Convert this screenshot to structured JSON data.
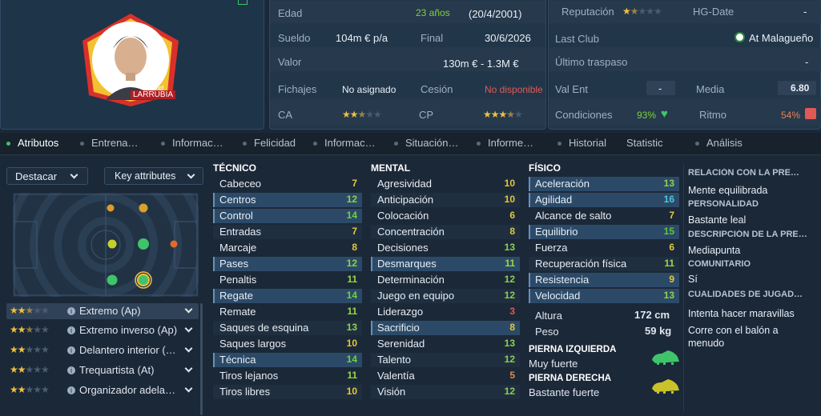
{
  "profile": {
    "name_first": "David",
    "name_last": "LARRUBIA"
  },
  "info": {
    "age_label": "Edad",
    "age_value": "23 años",
    "birth": "(20/4/2001)",
    "wage_label": "Sueldo",
    "wage_value": "104m € p/a",
    "final_label": "Final",
    "final_value": "30/6/2026",
    "value_label": "Valor",
    "value_value": "130m € - 1.3M €",
    "transfers_label": "Fichajes",
    "transfers_value": "No asignado",
    "loan_label": "Cesión",
    "loan_value": "No disponible",
    "ca_label": "CA",
    "ca_stars": 2.5,
    "cp_label": "CP",
    "cp_stars": 3.5
  },
  "info2": {
    "rep_label": "Reputación",
    "rep_stars": 1.5,
    "hg_label": "HG-Date",
    "hg_value": "-",
    "last_club_label": "Last Club",
    "last_club_value": "At Malagueño",
    "last_transfer_label": "Último traspaso",
    "last_transfer_value": "-",
    "val_ent_label": "Val Ent",
    "val_ent_value": "-",
    "media_label": "Media",
    "media_value": "6.80",
    "cond_label": "Condiciones",
    "cond_value": "93%",
    "ritmo_label": "Ritmo",
    "ritmo_value": "54%"
  },
  "tabs": [
    {
      "label": "Atributos",
      "active": true
    },
    {
      "label": "Entrena…",
      "active": false
    },
    {
      "label": "Informac…",
      "active": false
    },
    {
      "label": "Felicidad",
      "active": false
    },
    {
      "label": "Informac…",
      "active": false
    },
    {
      "label": "Situación…",
      "active": false
    },
    {
      "label": "Informe…",
      "active": false
    },
    {
      "label": "Historial",
      "active": false
    },
    {
      "label": "Statistic",
      "active": false
    },
    {
      "label": "Análisis",
      "active": false
    }
  ],
  "left": {
    "highlight_label": "Destacar",
    "key_attr_label": "Key attributes",
    "roles": [
      {
        "label": "Extremo (Ap)",
        "stars": 2.5
      },
      {
        "label": "Extremo inverso (Ap)",
        "stars": 2.5
      },
      {
        "label": "Delantero interior (…",
        "stars": 2
      },
      {
        "label": "Trequartista (At)",
        "stars": 2
      },
      {
        "label": "Organizador adela…",
        "stars": 2
      }
    ]
  },
  "tecnico": {
    "title": "TÉCNICO",
    "rows": [
      {
        "name": "Cabeceo",
        "value": "7",
        "hl": false
      },
      {
        "name": "Centros",
        "value": "12",
        "hl": true
      },
      {
        "name": "Control",
        "value": "14",
        "hl": true
      },
      {
        "name": "Entradas",
        "value": "7",
        "hl": false
      },
      {
        "name": "Marcaje",
        "value": "8",
        "hl": false
      },
      {
        "name": "Pases",
        "value": "12",
        "hl": true
      },
      {
        "name": "Penaltis",
        "value": "11",
        "hl": false
      },
      {
        "name": "Regate",
        "value": "14",
        "hl": true
      },
      {
        "name": "Remate",
        "value": "11",
        "hl": false
      },
      {
        "name": "Saques de esquina",
        "value": "13",
        "hl": false
      },
      {
        "name": "Saques largos",
        "value": "10",
        "hl": false
      },
      {
        "name": "Técnica",
        "value": "14",
        "hl": true
      },
      {
        "name": "Tiros lejanos",
        "value": "11",
        "hl": false
      },
      {
        "name": "Tiros libres",
        "value": "10",
        "hl": false
      }
    ]
  },
  "mental": {
    "title": "MENTAL",
    "rows": [
      {
        "name": "Agresividad",
        "value": "10",
        "hl": false
      },
      {
        "name": "Anticipación",
        "value": "10",
        "hl": false
      },
      {
        "name": "Colocación",
        "value": "6",
        "hl": false
      },
      {
        "name": "Concentración",
        "value": "8",
        "hl": false
      },
      {
        "name": "Decisiones",
        "value": "13",
        "hl": false
      },
      {
        "name": "Desmarques",
        "value": "11",
        "hl": true
      },
      {
        "name": "Determinación",
        "value": "12",
        "hl": false
      },
      {
        "name": "Juego en equipo",
        "value": "12",
        "hl": false
      },
      {
        "name": "Liderazgo",
        "value": "3",
        "hl": false
      },
      {
        "name": "Sacrificio",
        "value": "8",
        "hl": true
      },
      {
        "name": "Serenidad",
        "value": "13",
        "hl": false
      },
      {
        "name": "Talento",
        "value": "12",
        "hl": false
      },
      {
        "name": "Valentía",
        "value": "5",
        "hl": false
      },
      {
        "name": "Visión",
        "value": "12",
        "hl": false
      }
    ]
  },
  "fisico": {
    "title": "FÍSICO",
    "rows": [
      {
        "name": "Aceleración",
        "value": "13",
        "hl": true
      },
      {
        "name": "Agilidad",
        "value": "16",
        "hl": true
      },
      {
        "name": "Alcance de salto",
        "value": "7",
        "hl": false
      },
      {
        "name": "Equilibrio",
        "value": "15",
        "hl": true
      },
      {
        "name": "Fuerza",
        "value": "6",
        "hl": false
      },
      {
        "name": "Recuperación física",
        "value": "11",
        "hl": false
      },
      {
        "name": "Resistencia",
        "value": "9",
        "hl": true
      },
      {
        "name": "Velocidad",
        "value": "13",
        "hl": true
      }
    ],
    "height_label": "Altura",
    "height_value": "172 cm",
    "weight_label": "Peso",
    "weight_value": "59 kg",
    "left_foot_label": "PIERNA IZQUIERDA",
    "left_foot_value": "Muy fuerte",
    "right_foot_label": "PIERNA DERECHA",
    "right_foot_value": "Bastante fuerte"
  },
  "right_panel": {
    "h1": "RELACIÓN CON LA PRE…",
    "t1": "Mente equilibrada",
    "h2": "PERSONALIDAD",
    "t2": "Bastante leal",
    "h3": "DESCRIPCIÓN DE LA PRE…",
    "t3": "Mediapunta",
    "h4": "COMUNITARIO",
    "t4": "Sí",
    "h5": "CUALIDADES DE JUGAD…",
    "t5": "Intenta hacer maravillas",
    "t6": "Corre con el balón a menudo"
  },
  "colors": {
    "accent_green": "#3fc46a",
    "star": "#f0c040",
    "highlight_row": "#2c4a68"
  }
}
